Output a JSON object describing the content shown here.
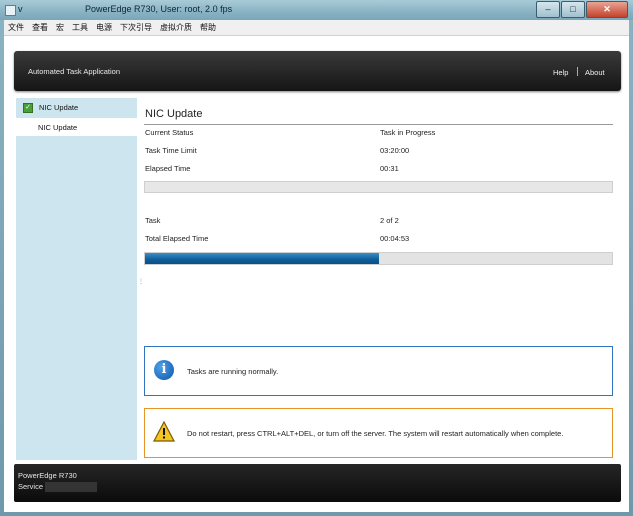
{
  "window": {
    "title_prefix": "v",
    "title": "PowerEdge R730, User: root, 2.0 fps",
    "controls": {
      "minimize_glyph": "–",
      "maximize_glyph": "□",
      "close_glyph": "✕"
    }
  },
  "menubar": {
    "items": [
      "文件",
      "查看",
      "宏",
      "工具",
      "电源",
      "下次引导",
      "虚拟介质",
      "帮助"
    ]
  },
  "header": {
    "title": "Automated Task Application",
    "help": "Help",
    "about": "About"
  },
  "sidebar": {
    "items": [
      {
        "label": "NIC Update",
        "checked": true
      },
      {
        "label": "NIC Update"
      }
    ]
  },
  "main": {
    "title": "NIC Update",
    "current_status": {
      "label": "Current Status",
      "value": "Task in Progress"
    },
    "time_limit": {
      "label": "Task Time Limit",
      "value": "03:20:00"
    },
    "elapsed": {
      "label": "Elapsed Time",
      "value": "00:31"
    },
    "task_progress_fraction": 0,
    "task": {
      "label": "Task",
      "value": "2 of 2"
    },
    "total_elapsed": {
      "label": "Total Elapsed Time",
      "value": "00:04:53"
    },
    "total_progress_fraction": 0.5,
    "info_message": "Tasks are running normally.",
    "warning_message": "Do not restart, press CTRL+ALT+DEL, or turn off the server.  The system will restart automatically when complete."
  },
  "footer": {
    "model": "PowerEdge R730",
    "service_label": "Service"
  },
  "colors": {
    "accent_blue": "#0f5d99",
    "info_border": "#2f75c0",
    "warning_border": "#e69528",
    "sidebar_bg": "#cde5ee"
  }
}
